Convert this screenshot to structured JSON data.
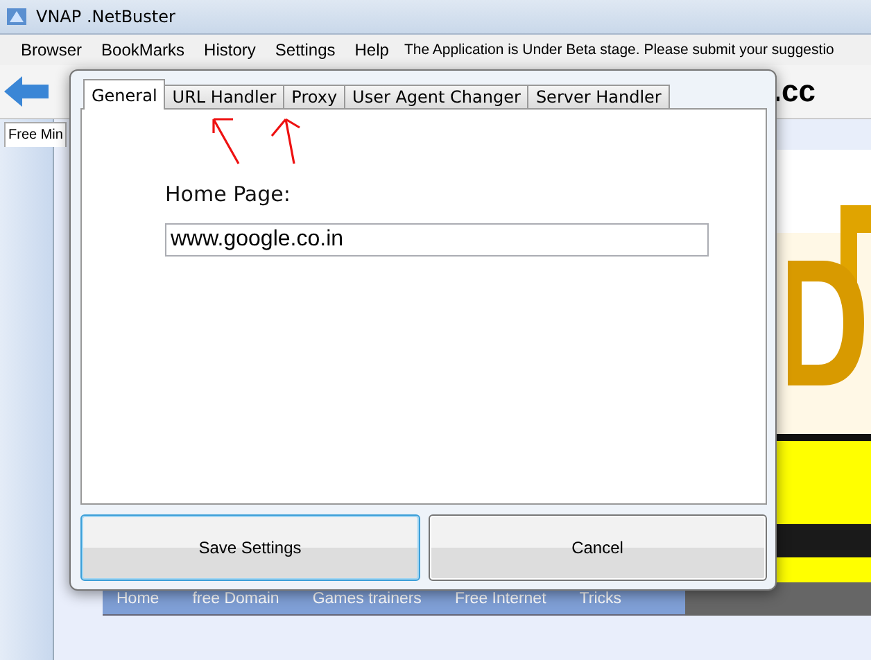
{
  "window": {
    "title": "VNAP .NetBuster"
  },
  "menu": [
    {
      "label": "Browser"
    },
    {
      "label": "BookMarks"
    },
    {
      "label": "History"
    },
    {
      "label": "Settings"
    },
    {
      "label": "Help"
    }
  ],
  "notice": "The Application is Under Beta stage. Please submit your suggestio",
  "browser_tab": {
    "label": "Free Min"
  },
  "site": {
    "title_fragment": ".cc",
    "nav": [
      "Home",
      "free Domain",
      "Games trainers",
      "Free Internet",
      "Tricks"
    ]
  },
  "dialog": {
    "tabs": [
      {
        "label": "General",
        "selected": true
      },
      {
        "label": "URL Handler",
        "selected": false
      },
      {
        "label": "Proxy",
        "selected": false
      },
      {
        "label": "User Agent Changer",
        "selected": false
      },
      {
        "label": "Server Handler",
        "selected": false
      }
    ],
    "field": {
      "label": "Home Page:",
      "value": "www.google.co.in"
    },
    "buttons": [
      {
        "label": "Save Settings",
        "focused": true
      },
      {
        "label": "Cancel",
        "focused": false
      }
    ]
  },
  "annotations": [
    {
      "kind": "arrow"
    },
    {
      "kind": "arrow"
    }
  ]
}
